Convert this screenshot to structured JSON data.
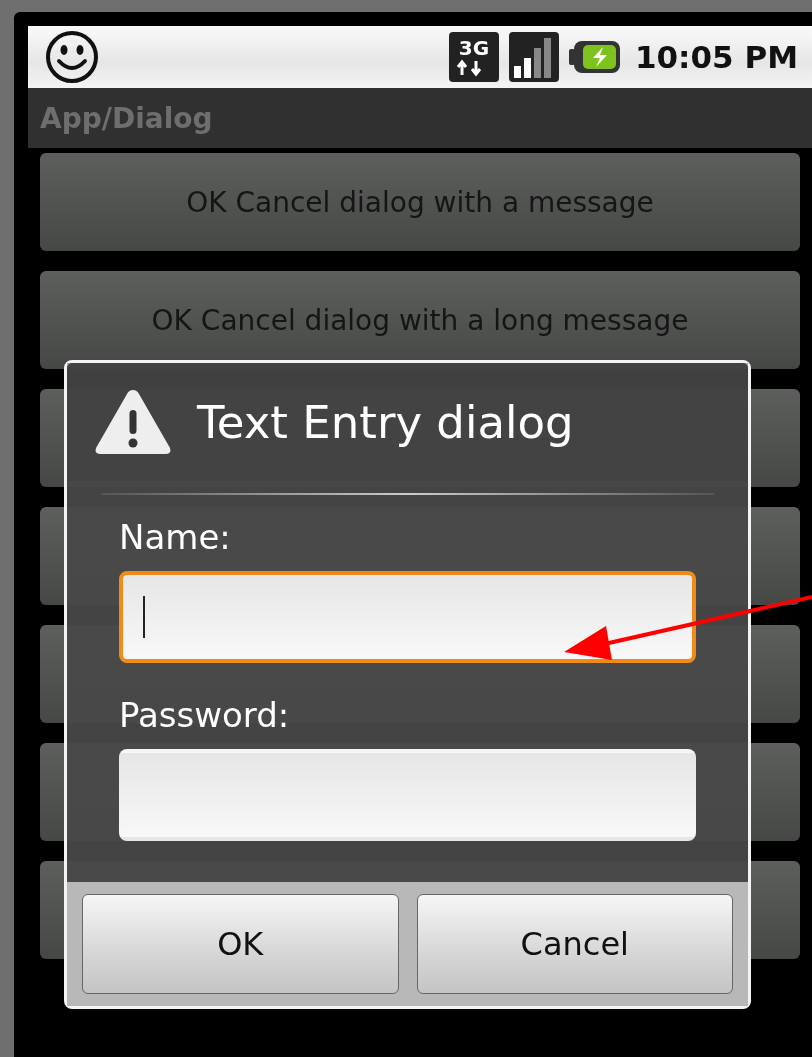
{
  "status_bar": {
    "network": "3G",
    "time": "10:05 PM"
  },
  "title": "App/Dialog",
  "list_buttons": [
    {
      "label": "OK Cancel dialog with a message"
    },
    {
      "label": "OK Cancel dialog with a long message"
    }
  ],
  "dialog": {
    "title": "Text Entry dialog",
    "fields": [
      {
        "label": "Name:",
        "focused": true
      },
      {
        "label": "Password:",
        "focused": false
      }
    ],
    "buttons": [
      "OK",
      "Cancel"
    ]
  }
}
